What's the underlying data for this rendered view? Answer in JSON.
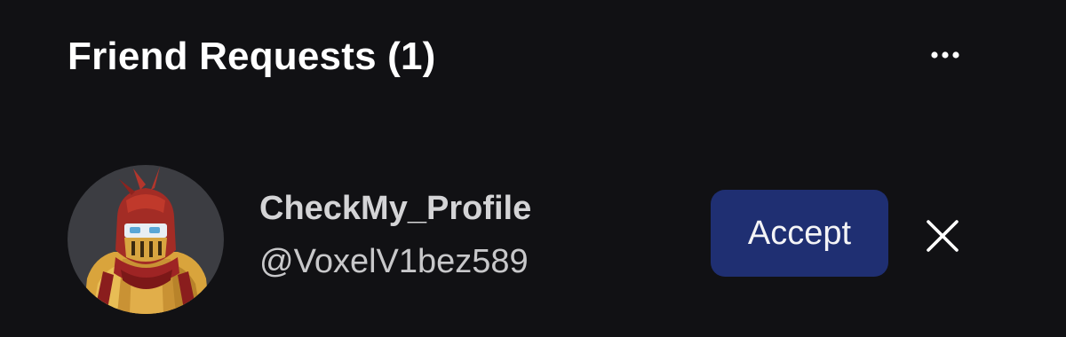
{
  "header": {
    "title": "Friend Requests (1)",
    "menu_icon": "more-horizontal-icon"
  },
  "requests": [
    {
      "display_name": "CheckMy_Profile",
      "username": "@VoxelV1bez589",
      "avatar": "armored-knight-avatar",
      "accept_label": "Accept",
      "decline_icon": "close-icon"
    }
  ],
  "colors": {
    "background": "#111114",
    "accept_button": "#1f2f72",
    "avatar_background": "#3c3d42"
  }
}
